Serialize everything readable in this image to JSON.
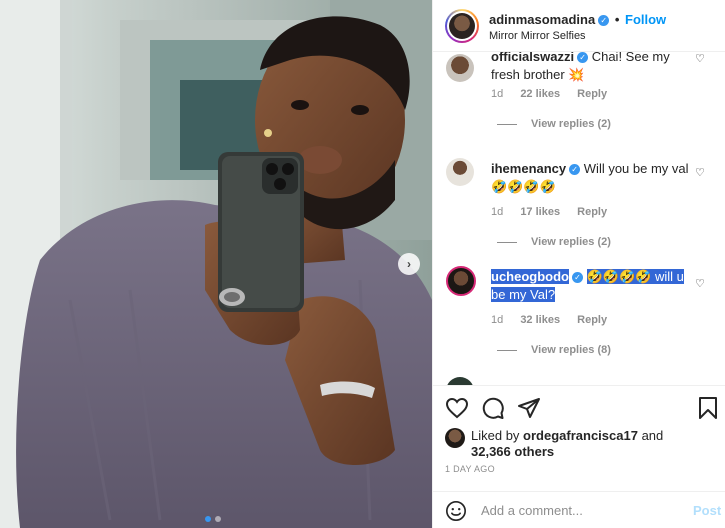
{
  "post": {
    "author": "adinmasomadina",
    "follow_label": "Follow",
    "location": "Mirror Mirror Selfies",
    "separator": "•"
  },
  "comments": [
    {
      "username": "officialswazzi",
      "text": "Chai! See my fresh brother 💥",
      "time": "1d",
      "likes": "22 likes",
      "reply": "Reply",
      "view_replies": "View replies (2)",
      "verified": true
    },
    {
      "username": "ihemenancy",
      "text": "Will you be my val 🤣🤣🤣🤣",
      "time": "1d",
      "likes": "17 likes",
      "reply": "Reply",
      "view_replies": "View replies (2)",
      "verified": true
    },
    {
      "username": "ucheogbodo",
      "text": "🤣🤣🤣🤣 will u be my Val?",
      "time": "1d",
      "likes": "32 likes",
      "reply": "Reply",
      "view_replies": "View replies (8)",
      "verified": true
    }
  ],
  "likes": {
    "prefix": "Liked by",
    "user": "ordegafrancisca17",
    "and": "and",
    "others": "32,366 others"
  },
  "timestamp": "1 DAY AGO",
  "add_comment": {
    "placeholder": "Add a comment...",
    "post_label": "Post"
  },
  "icons": {
    "like": "heart-icon",
    "comment": "comment-icon",
    "share": "paper-plane-icon",
    "save": "bookmark-icon",
    "emoji": "smiley-icon"
  },
  "colors": {
    "accent": "#0095f6",
    "verified": "#3897f0",
    "muted": "#8e8e8e",
    "selection": "#3367d6"
  }
}
